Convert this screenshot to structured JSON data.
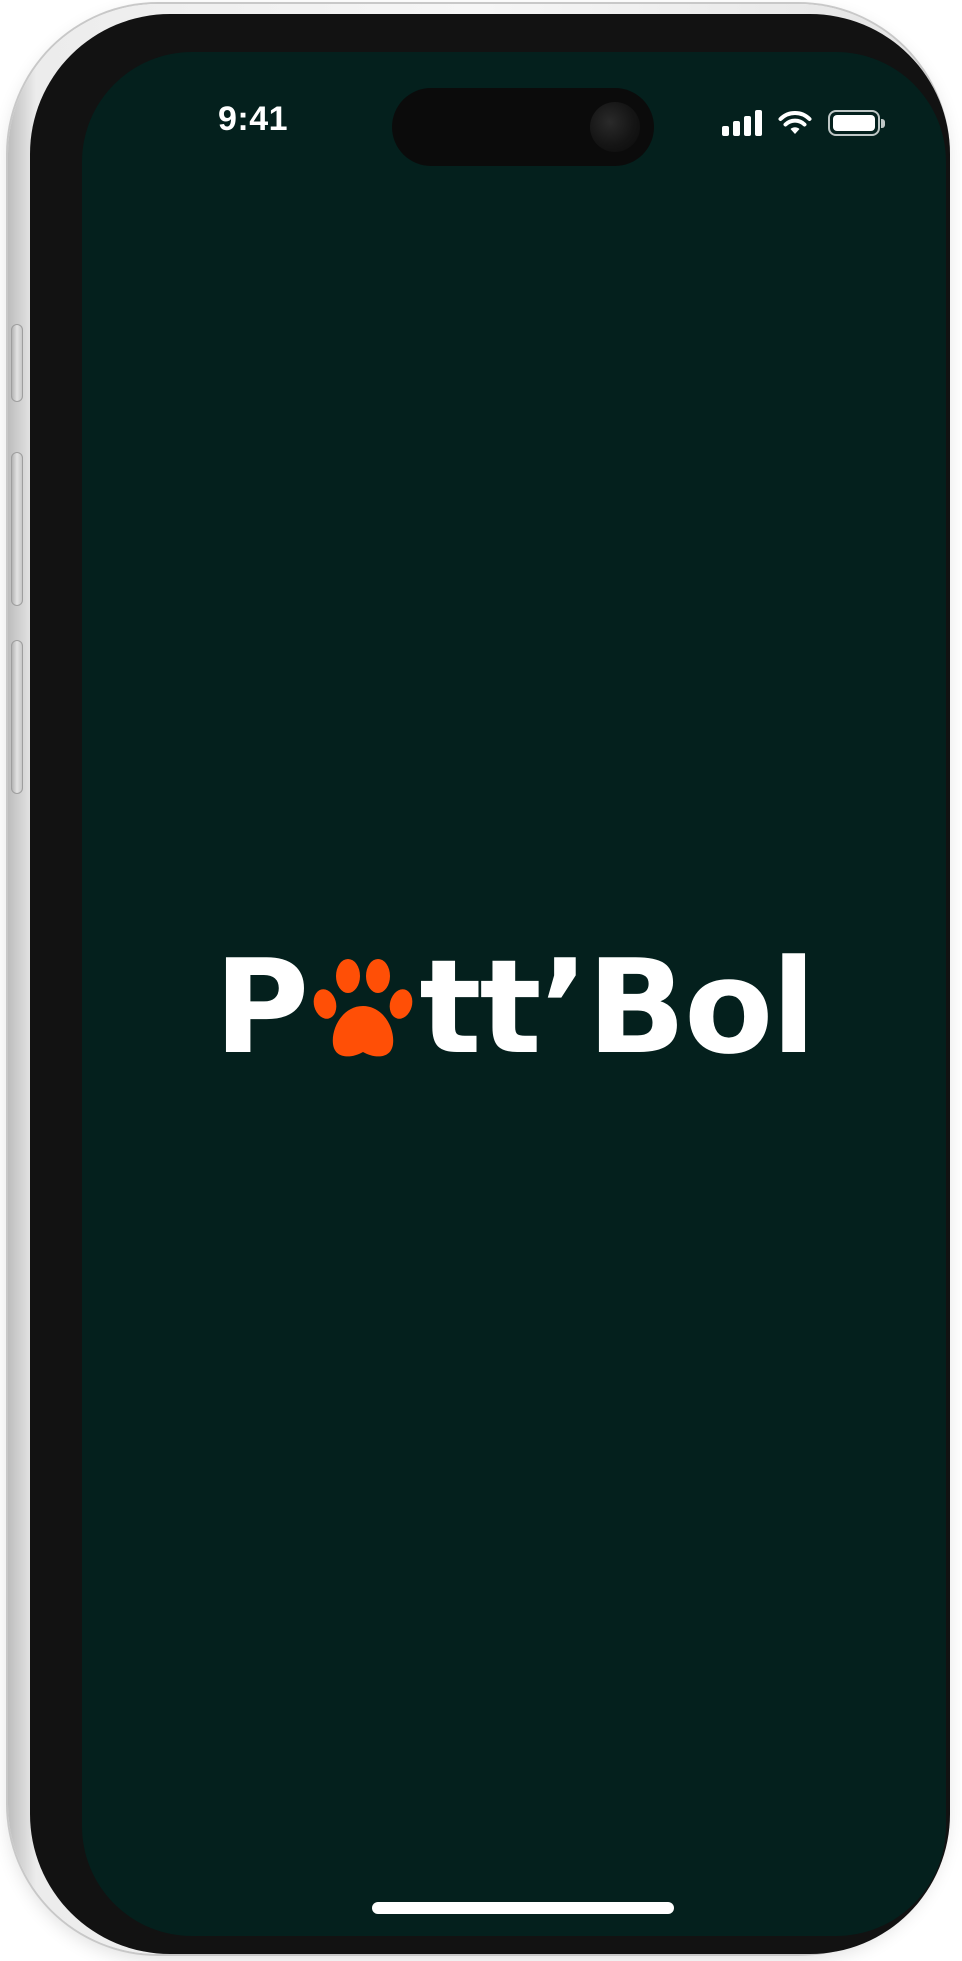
{
  "status_bar": {
    "time": "9:41",
    "signal_icon": "cellular-signal-icon",
    "wifi_icon": "wifi-icon",
    "battery_icon": "battery-full-icon"
  },
  "splash": {
    "logo_prefix": "P",
    "logo_suffix": "tt’Bol",
    "logo_icon": "paw-icon",
    "colors": {
      "background": "#04201d",
      "logo_text": "#ffffff",
      "paw": "#ff4f06"
    }
  }
}
